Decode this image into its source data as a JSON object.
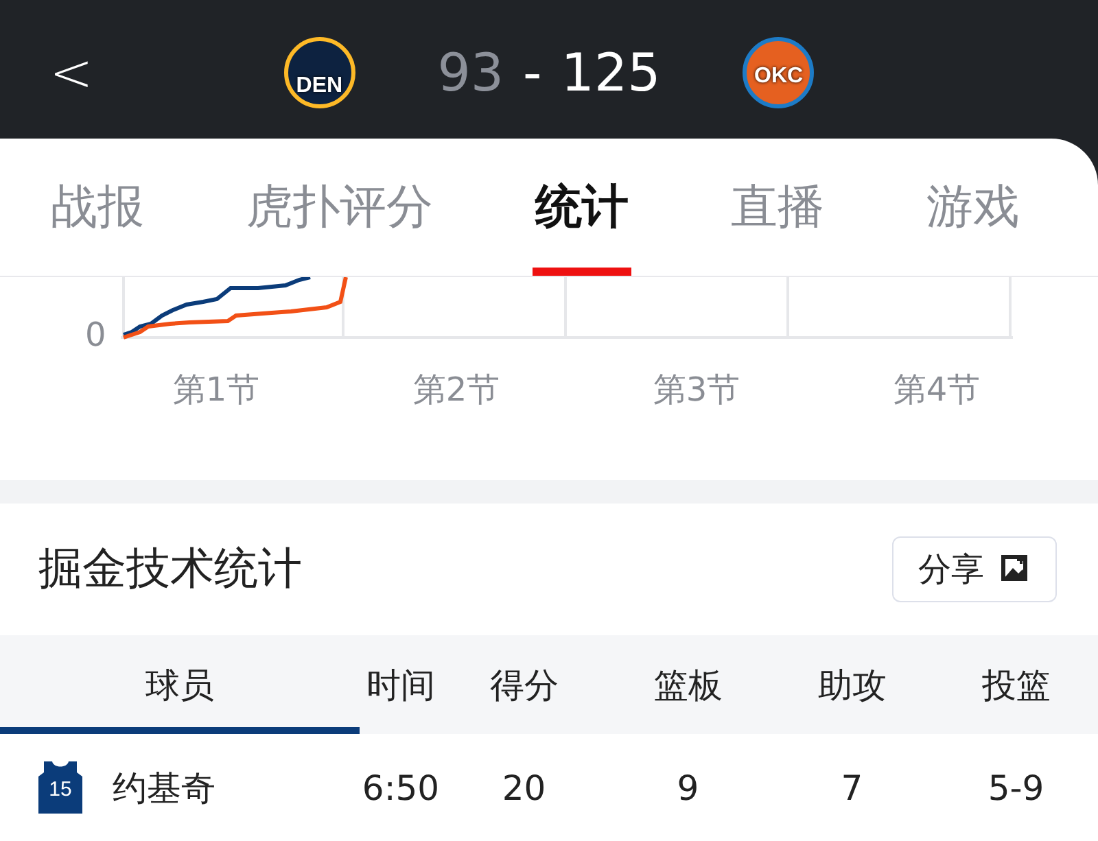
{
  "header": {
    "back": "<",
    "home_team": "DEN",
    "away_team": "OKC",
    "home_score": "93",
    "separator": "-",
    "away_score": "125"
  },
  "tabs": [
    {
      "label": "战报",
      "selected": false
    },
    {
      "label": "虎扑评分",
      "selected": false
    },
    {
      "label": "统计",
      "selected": true
    },
    {
      "label": "直播",
      "selected": false
    },
    {
      "label": "游戏",
      "selected": false
    }
  ],
  "score_chart": {
    "y_tick": "0",
    "quarters": [
      "第1节",
      "第2节",
      "第3节",
      "第4节"
    ]
  },
  "stats": {
    "title": "掘金技术统计",
    "share": "分享",
    "columns": [
      {
        "label": "球员",
        "selected": true
      },
      {
        "label": "时间",
        "selected": false
      },
      {
        "label": "得分",
        "selected": false
      },
      {
        "label": "篮板",
        "selected": false
      },
      {
        "label": "助攻",
        "selected": false
      },
      {
        "label": "投篮",
        "selected": false
      }
    ],
    "rows": [
      {
        "number": "15",
        "cells": [
          "约基奇",
          "6:50",
          "20",
          "9",
          "7",
          "5-9"
        ]
      }
    ]
  }
}
